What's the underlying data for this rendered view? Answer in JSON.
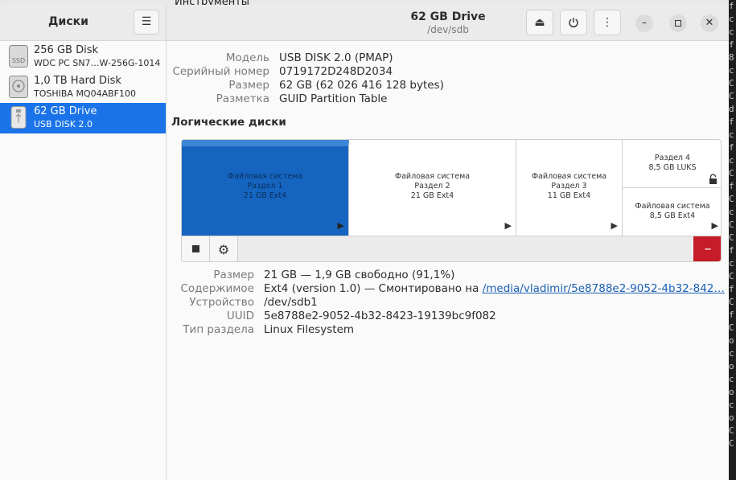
{
  "background": {
    "behind_window_title": "Инструменты",
    "terminal_chars": [
      "f",
      "c",
      "c",
      "f",
      "8",
      "c",
      "C",
      "C",
      "d",
      "f",
      "c",
      "f",
      "c",
      "C",
      "f",
      "C",
      "c",
      "C",
      "C",
      "f",
      "c",
      "C",
      "f",
      "C",
      "f",
      "C",
      "o",
      "c",
      "o",
      "c",
      "o",
      "c",
      "o",
      "C",
      "C"
    ]
  },
  "sidebar": {
    "title": "Диски",
    "menu_icon": "hamburger-menu-icon",
    "disks": [
      {
        "name": "256 GB Disk",
        "model": "WDC PC SN7…W-256G-1014",
        "icon": "ssd-icon",
        "icon_text": "SSD",
        "selected": false
      },
      {
        "name": "1,0 TB Hard Disk",
        "model": "TOSHIBA MQ04ABF100",
        "icon": "hard-disk-icon",
        "selected": false
      },
      {
        "name": "62 GB Drive",
        "model": "USB DISK 2.0",
        "icon": "usb-drive-icon",
        "selected": true
      }
    ]
  },
  "header": {
    "title": "62 GB Drive",
    "subtitle": "/dev/sdb",
    "eject_icon": "eject-icon",
    "power_icon": "power-icon",
    "more_icon": "more-vertical-icon"
  },
  "drive_props": [
    {
      "label": "Модель",
      "value": "USB DISK 2.0 (PMAP)"
    },
    {
      "label": "Серийный номер",
      "value": "0719172D248D2034"
    },
    {
      "label": "Размер",
      "value": "62 GB (62 026 416 128 bytes)"
    },
    {
      "label": "Разметка",
      "value": "GUID Partition Table"
    }
  ],
  "volumes_title": "Логические диски",
  "volumes": [
    {
      "line1": "Файловая система",
      "line2": "Раздел 1",
      "line3": "21 GB Ext4",
      "selected": true
    },
    {
      "line1": "Файловая система",
      "line2": "Раздел 2",
      "line3": "21 GB Ext4",
      "selected": false
    },
    {
      "line1": "Файловая система",
      "line2": "Раздел 3",
      "line3": "11 GB Ext4",
      "selected": false
    },
    {
      "line1": "Раздел 4",
      "line2": "8,5 GB LUKS",
      "selected": false
    },
    {
      "line1": "Файловая система",
      "line2": "8,5 GB Ext4",
      "selected": false
    }
  ],
  "volume_props": {
    "size": {
      "label": "Размер",
      "value": "21 GB — 1,9 GB свободно (91,1%)"
    },
    "contents": {
      "label": "Содержимое",
      "value": "Ext4 (version 1.0) — Смонтировано на",
      "link": "/media/vladimir/5e8788e2-9052-4b32-842…"
    },
    "device": {
      "label": "Устройство",
      "value": "/dev/sdb1"
    },
    "uuid": {
      "label": "UUID",
      "value": "5e8788e2-9052-4b32-8423-19139bc9f082"
    },
    "type": {
      "label": "Тип раздела",
      "value": "Linux Filesystem"
    }
  },
  "colors": {
    "accent": "#1a73e8",
    "selected_volume": "#1565c0",
    "delete": "#c61b28",
    "link": "#1a5fb4"
  }
}
